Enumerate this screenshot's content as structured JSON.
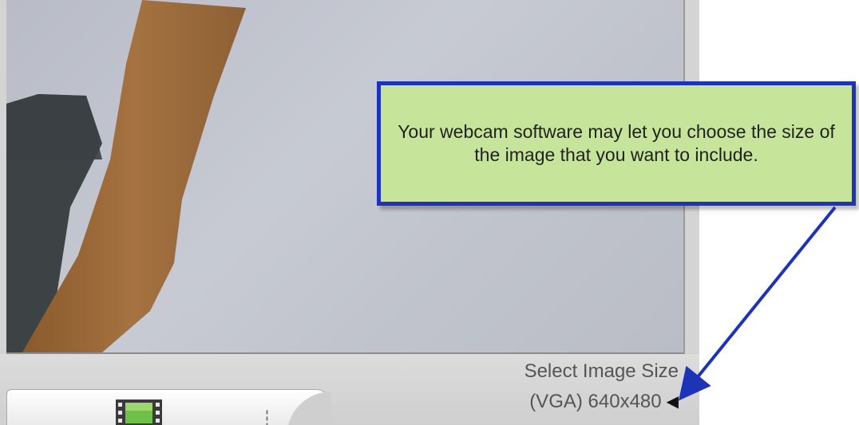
{
  "preview": {
    "description_icon": "webcam-preview"
  },
  "toolbar": {
    "record_video_icon": "film-icon"
  },
  "image_size": {
    "label": "Select Image Size",
    "current_value": "(VGA) 640x480",
    "arrow_icon": "triangle-left-icon"
  },
  "callout": {
    "text": "Your webcam software may let you choose the size of the image that you want to include.",
    "fill_color": "#c6e59a",
    "border_color": "#1d33b8",
    "arrow_color": "#1d33b8"
  }
}
